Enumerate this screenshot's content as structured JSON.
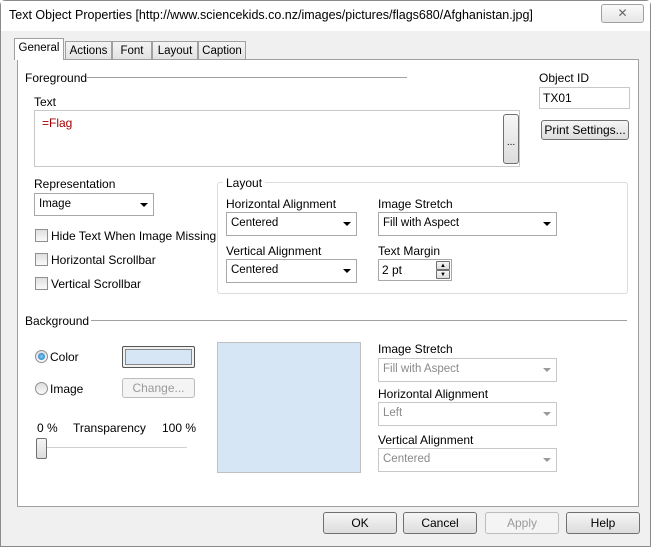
{
  "window": {
    "title": "Text Object Properties [http://www.sciencekids.co.nz/images/pictures/flags680/Afghanistan.jpg]",
    "close_icon": "close-icon"
  },
  "tabs": [
    {
      "label": "General",
      "active": true
    },
    {
      "label": "Actions"
    },
    {
      "label": "Font"
    },
    {
      "label": "Layout"
    },
    {
      "label": "Caption"
    }
  ],
  "foreground": {
    "label": "Foreground",
    "text_label": "Text",
    "text_value": "=Flag",
    "ellipsis": "...",
    "object_id_label": "Object ID",
    "object_id": "TX01",
    "print_settings": "Print Settings...",
    "representation_label": "Representation",
    "representation": "Image",
    "checkboxes": [
      {
        "label": "Hide Text When Image Missing",
        "checked": false
      },
      {
        "label": "Horizontal Scrollbar",
        "checked": false
      },
      {
        "label": "Vertical Scrollbar",
        "checked": false
      }
    ],
    "layout": {
      "label": "Layout",
      "h_align_label": "Horizontal Alignment",
      "h_align": "Centered",
      "image_stretch_label": "Image Stretch",
      "image_stretch": "Fill with Aspect",
      "v_align_label": "Vertical Alignment",
      "v_align": "Centered",
      "text_margin_label": "Text Margin",
      "text_margin": "2 pt"
    }
  },
  "background": {
    "label": "Background",
    "color_label": "Color",
    "image_label": "Image",
    "change": "Change...",
    "selected": "Color",
    "color": "#d6e6f4",
    "transparency_label": "Transparency",
    "min": "0 %",
    "max": "100 %",
    "transparency_value": 0,
    "image_stretch_label": "Image Stretch",
    "image_stretch": "Fill with Aspect",
    "h_align_label": "Horizontal Alignment",
    "h_align": "Left",
    "v_align_label": "Vertical Alignment",
    "v_align": "Centered"
  },
  "buttons": {
    "ok": "OK",
    "cancel": "Cancel",
    "apply": "Apply",
    "help": "Help"
  }
}
